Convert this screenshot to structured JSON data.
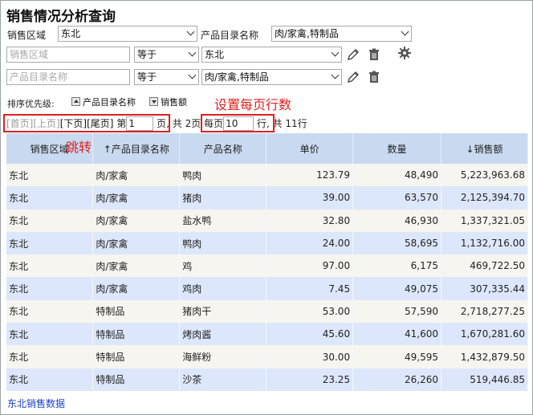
{
  "page_title": "销售情况分析查询",
  "filters": {
    "row1": {
      "region_label": "销售区域",
      "region_value": "东北",
      "category_label": "产品目录名称",
      "category_value": "肉/家禽,特制品"
    },
    "row2": {
      "field_placeholder": "销售区域",
      "op": "等于",
      "value": "东北"
    },
    "row3": {
      "field_placeholder": "产品目录名称",
      "op": "等于",
      "value": "肉/家禽,特制品"
    },
    "icons": {
      "edit": "pencil-icon",
      "delete": "trash-icon",
      "settings": "gear-icon"
    }
  },
  "sort": {
    "label": "排序优先级:",
    "items": [
      {
        "label": "产品目录名称",
        "dir": "up"
      },
      {
        "label": "销售额",
        "dir": "down"
      }
    ]
  },
  "annotations": {
    "rows_per_page": "设置每页行数",
    "jump": "跳转",
    "color": "#e02020"
  },
  "pager": {
    "first": "[首页]",
    "prev": "[上页]",
    "next": "[下页]",
    "last": "[尾页]",
    "page_prefix": "第",
    "page_value": "1",
    "page_suffix": "页,",
    "total_pages": "共 2页",
    "per_page_prefix": "每页",
    "per_page_value": "10",
    "per_page_suffix": "行,",
    "total_rows": "共 11行"
  },
  "table": {
    "headers": [
      "销售区域",
      "↑产品目录名称",
      "产品名称",
      "单价",
      "数量",
      "↓销售额"
    ],
    "rows": [
      [
        "东北",
        "肉/家禽",
        "鸭肉",
        "123.79",
        "48,490",
        "5,223,963.68"
      ],
      [
        "东北",
        "肉/家禽",
        "猪肉",
        "39.00",
        "63,570",
        "2,125,394.70"
      ],
      [
        "东北",
        "肉/家禽",
        "盐水鸭",
        "32.80",
        "46,930",
        "1,337,321.05"
      ],
      [
        "东北",
        "肉/家禽",
        "鸭肉",
        "24.00",
        "58,695",
        "1,132,716.00"
      ],
      [
        "东北",
        "肉/家禽",
        "鸡",
        "97.00",
        "6,175",
        "469,722.50"
      ],
      [
        "东北",
        "肉/家禽",
        "鸡肉",
        "7.45",
        "49,075",
        "307,335.44"
      ],
      [
        "东北",
        "特制品",
        "猪肉干",
        "53.00",
        "57,590",
        "2,718,277.25"
      ],
      [
        "东北",
        "特制品",
        "烤肉酱",
        "45.60",
        "41,600",
        "1,670,281.60"
      ],
      [
        "东北",
        "特制品",
        "海鲜粉",
        "30.00",
        "49,595",
        "1,432,879.50"
      ],
      [
        "东北",
        "特制品",
        "沙茶",
        "23.25",
        "26,260",
        "519,446.85"
      ]
    ]
  },
  "footer_link": "东北销售数据"
}
